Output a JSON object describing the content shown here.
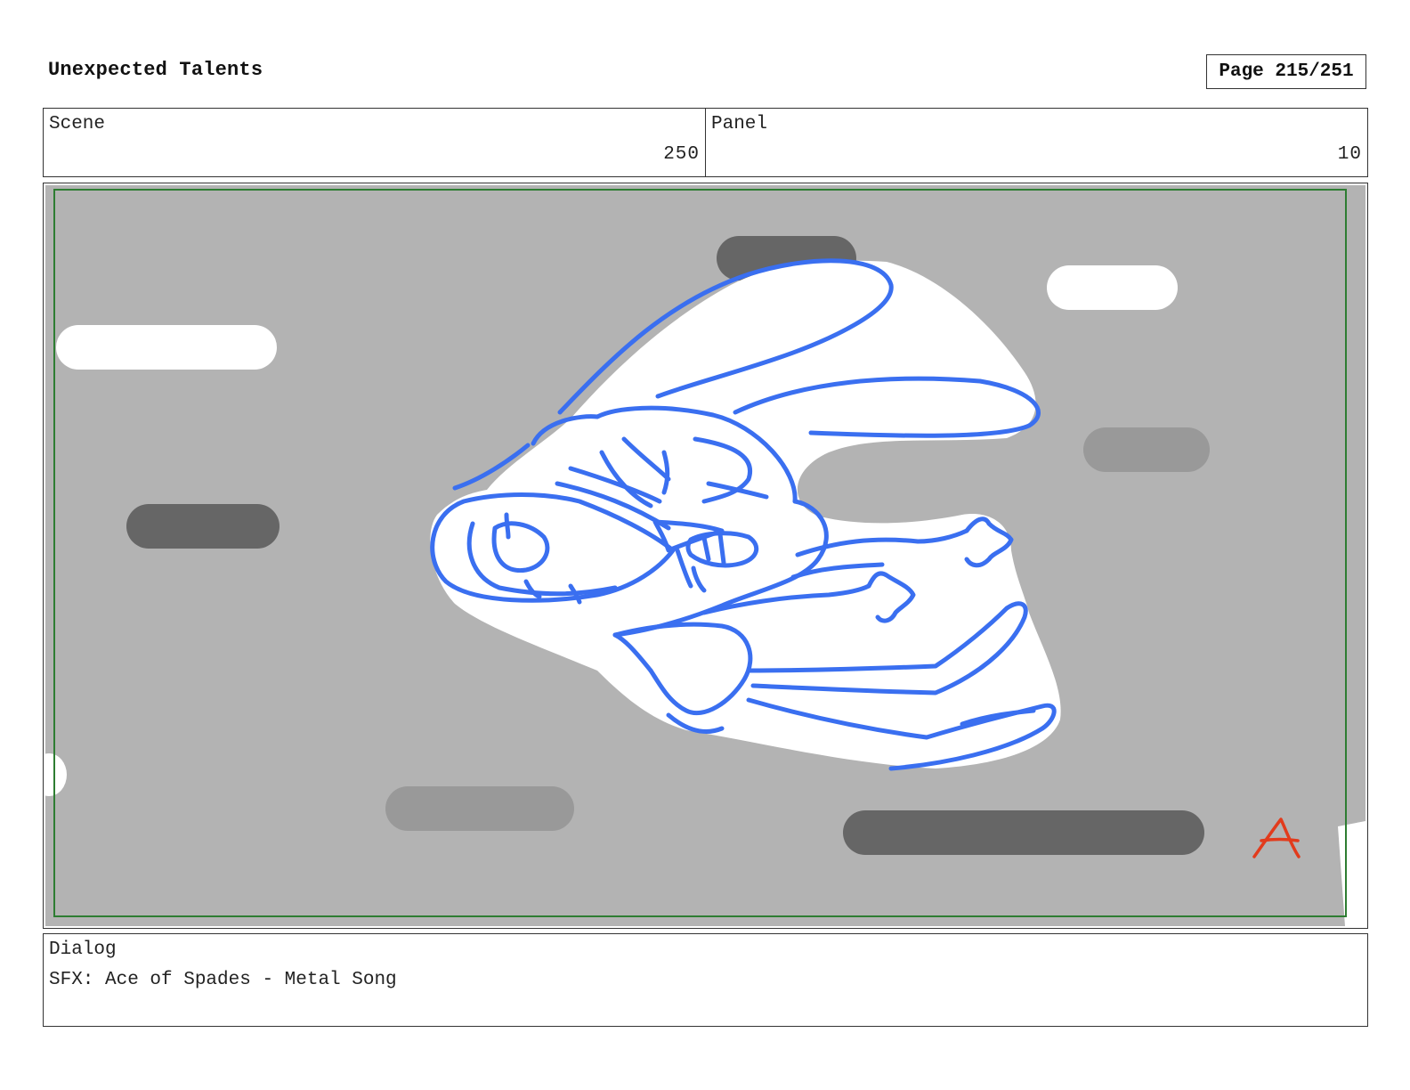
{
  "header": {
    "title": "Unexpected Talents",
    "page_label": "Page 215/251"
  },
  "scene": {
    "label": "Scene",
    "value": "250"
  },
  "panel": {
    "label": "Panel",
    "value": "10"
  },
  "frame": {
    "corner_mark": "A",
    "colors": {
      "background": "#b3b3b3",
      "border": "#2e7d32",
      "sketch": "#3a6ff0",
      "mark": "#e23b1c"
    }
  },
  "dialog": {
    "label": "Dialog",
    "text": "SFX: Ace of Spades - Metal Song"
  }
}
